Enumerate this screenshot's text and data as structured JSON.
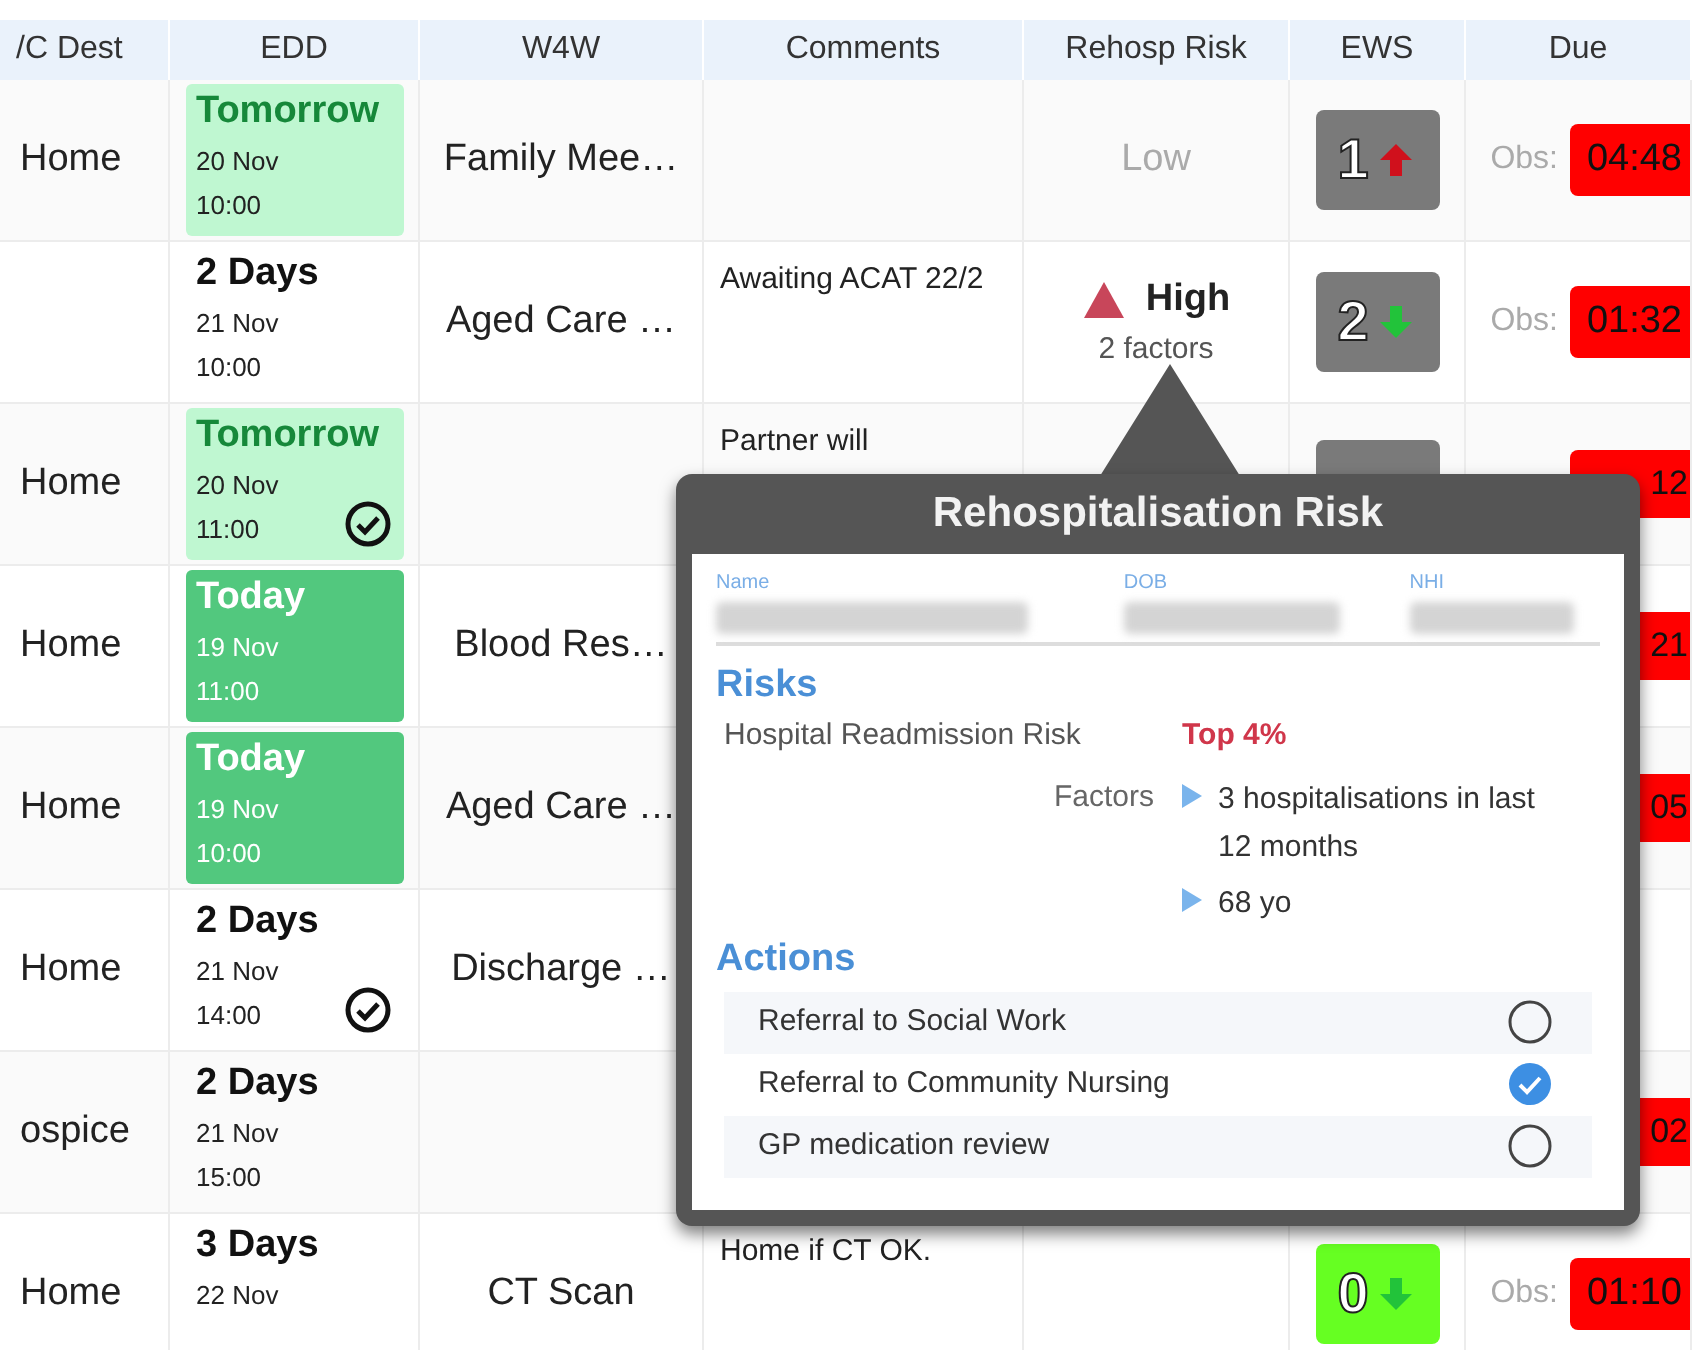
{
  "table": {
    "columns": [
      "/C Dest",
      "EDD",
      "W4W",
      "Comments",
      "Rehosp Risk",
      "EWS",
      "Due"
    ],
    "rows": [
      {
        "dest": "Home",
        "edd": {
          "kind": "tomorrow",
          "label": "Tomorrow",
          "date": "20 Nov",
          "time": "10:00",
          "confirmed": false
        },
        "w4w": "Family Mee…",
        "risk": {
          "kind": "low",
          "label": "Low"
        },
        "ews": {
          "kind": "grey",
          "score": "1",
          "rising": true
        },
        "due": {
          "label": "Obs:",
          "time": "04:48"
        }
      },
      {
        "edd": {
          "kind": "plain",
          "label": "2 Days",
          "date": "21 Nov",
          "time": "10:00",
          "confirmed": false
        },
        "w4w": "Aged Care …",
        "comments": "Awaiting ACAT 22/2",
        "risk": {
          "kind": "high",
          "label": "High",
          "factors": "2 factors"
        },
        "ews": {
          "kind": "grey",
          "score": "2",
          "rising": false
        },
        "due": {
          "label": "Obs:",
          "time": "01:32"
        }
      },
      {
        "dest": "Home",
        "edd": {
          "kind": "tomorrow",
          "label": "Tomorrow",
          "date": "20 Nov",
          "time": "11:00",
          "confirmed": true
        },
        "comments": "Partner will",
        "ews": {
          "kind": "grey"
        },
        "due": {
          "time": "12"
        }
      },
      {
        "dest": "Home",
        "edd": {
          "kind": "today",
          "label": "Today",
          "date": "19 Nov",
          "time": "11:00",
          "confirmed": false
        },
        "w4w": "Blood Res…",
        "due": {
          "time": "21"
        }
      },
      {
        "dest": "Home",
        "edd": {
          "kind": "today",
          "label": "Today",
          "date": "19 Nov",
          "time": "10:00",
          "confirmed": false
        },
        "w4w": "Aged Care …",
        "due": {
          "time": "05"
        }
      },
      {
        "dest": "Home",
        "edd": {
          "kind": "plain",
          "label": "2 Days",
          "date": "21 Nov",
          "time": "14:00",
          "confirmed": true
        },
        "w4w": "Discharge …"
      },
      {
        "dest": "ospice",
        "edd": {
          "kind": "plain",
          "label": "2 Days",
          "date": "21 Nov",
          "time": "15:00",
          "confirmed": false
        },
        "due": {
          "time": "02"
        }
      },
      {
        "dest": "Home",
        "edd": {
          "kind": "plain",
          "label": "3 Days",
          "date": "22 Nov",
          "confirmed": false
        },
        "w4w": "CT Scan",
        "comments": "Home if CT OK.",
        "ews": {
          "kind": "lime",
          "score": "0",
          "rising": false
        },
        "due": {
          "label": "Obs:",
          "time": "01:10"
        }
      }
    ]
  },
  "popover": {
    "title": "Rehospitalisation Risk",
    "patient": [
      {
        "label": "Name"
      },
      {
        "label": "DOB"
      },
      {
        "label": "NHI"
      }
    ],
    "risks_heading": "Risks",
    "risk_label": "Hospital Readmission Risk",
    "risk_value": "Top 4%",
    "factors_label": "Factors",
    "factors": [
      "3 hospitalisations in last 12 months",
      "68 yo"
    ],
    "actions_heading": "Actions",
    "actions": [
      {
        "label": "Referral to Social Work",
        "checked": false
      },
      {
        "label": "Referral to Community Nursing",
        "checked": true
      },
      {
        "label": "GP medication review",
        "checked": false
      }
    ]
  }
}
